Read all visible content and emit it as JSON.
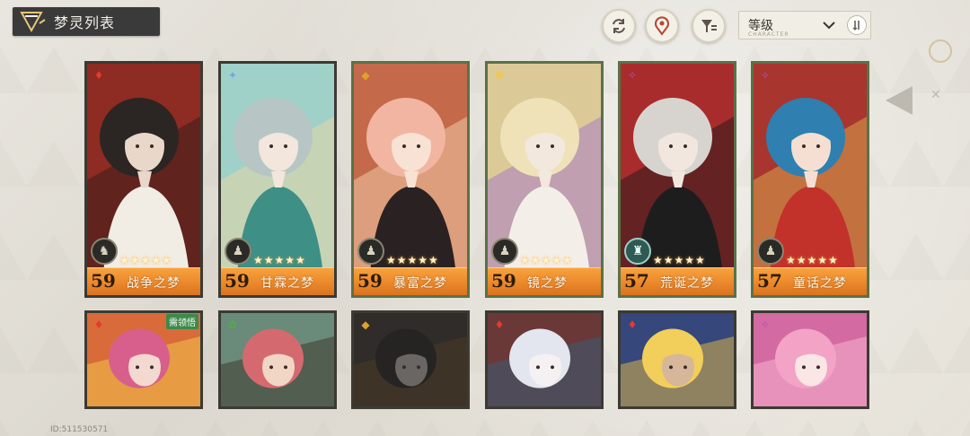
{
  "header": {
    "title": "梦灵列表"
  },
  "toolbar": {
    "sort_label": "等级",
    "sort_sub": "CHARACTER",
    "icons": [
      "refresh-icon",
      "location-pin-icon",
      "filter-icon",
      "sort-order-icon"
    ]
  },
  "cards": [
    {
      "level": "59",
      "name": "战争之梦",
      "stars": "★★★★★",
      "element": "fire",
      "role": "knight",
      "frame": "dark",
      "palette": {
        "bg": "#8e2b22",
        "bg2": "#3b1e1a",
        "hair": "#2b2523",
        "skin": "#e9d7c9",
        "cloth": "#f1ede4"
      }
    },
    {
      "level": "59",
      "name": "甘霖之梦",
      "stars": "★★★★★",
      "element": "water",
      "role": "pawn",
      "frame": "dark",
      "palette": {
        "bg": "#9fd1c9",
        "bg2": "#e6d7a4",
        "hair": "#b7c6c4",
        "skin": "#f3e6dc",
        "cloth": "#3e8f86"
      }
    },
    {
      "level": "59",
      "name": "暴富之梦",
      "stars": "★★★★★",
      "element": "gold",
      "role": "pawn",
      "frame": "green",
      "palette": {
        "bg": "#c46a4a",
        "bg2": "#f0c9a6",
        "hair": "#f2b5a2",
        "skin": "#f8e2d3",
        "cloth": "#2a2222"
      }
    },
    {
      "level": "59",
      "name": "镜之梦",
      "stars": "★★★★★",
      "element": "light",
      "role": "pawn",
      "frame": "green",
      "palette": {
        "bg": "#dcc998",
        "bg2": "#a77bc5",
        "hair": "#efe2b8",
        "skin": "#f3e8de",
        "cloth": "#f3efe8"
      }
    },
    {
      "level": "57",
      "name": "荒诞之梦",
      "stars": "★★★★★",
      "element": "dark",
      "role": "rook",
      "frame": "green",
      "palette": {
        "bg": "#a92c2c",
        "bg2": "#2b1b1d",
        "hair": "#d7d4cf",
        "skin": "#f2e7df",
        "cloth": "#1e1d1e"
      }
    },
    {
      "level": "57",
      "name": "童话之梦",
      "stars": "★★★★★",
      "element": "dark",
      "role": "pawn",
      "frame": "green",
      "palette": {
        "bg": "#a8352e",
        "bg2": "#d8a34d",
        "hair": "#2f7fb0",
        "skin": "#f4dfd2",
        "cloth": "#c2322b"
      }
    },
    {
      "element": "fire",
      "frame": "dark",
      "badge": "需领悟",
      "palette": {
        "bg": "#d96b3a",
        "bg2": "#f2c34b",
        "hair": "#d85f8b",
        "skin": "#f3d9cf",
        "cloth": "#4b2a3c"
      }
    },
    {
      "element": "nature",
      "frame": "dark",
      "palette": {
        "bg": "#6a8b79",
        "bg2": "#3e3a2e",
        "hair": "#d46a6f",
        "skin": "#f1d6c6",
        "cloth": "#3b3a36"
      }
    },
    {
      "element": "gold",
      "frame": "dark",
      "palette": {
        "bg": "#2f2c2a",
        "bg2": "#4a3a25",
        "hair": "#262422",
        "skin": "#6a6663",
        "cloth": "#d0922e"
      }
    },
    {
      "element": "fire",
      "frame": "dark",
      "palette": {
        "bg": "#6b3838",
        "bg2": "#3a5b74",
        "hair": "#e4e6ef",
        "skin": "#f5f1f2",
        "cloth": "#7b78a6"
      }
    },
    {
      "element": "fire",
      "frame": "dark",
      "palette": {
        "bg": "#35477b",
        "bg2": "#d8b34a",
        "hair": "#f1cf5a",
        "skin": "#d6b79a",
        "cloth": "#2a3772"
      }
    },
    {
      "element": "dark",
      "frame": "dark",
      "palette": {
        "bg": "#d46aa2",
        "bg2": "#f5b2cf",
        "hair": "#f2a3c6",
        "skin": "#fae6e4",
        "cloth": "#cf4f8d"
      }
    }
  ],
  "footer": {
    "player_id": "ID:511530571"
  }
}
